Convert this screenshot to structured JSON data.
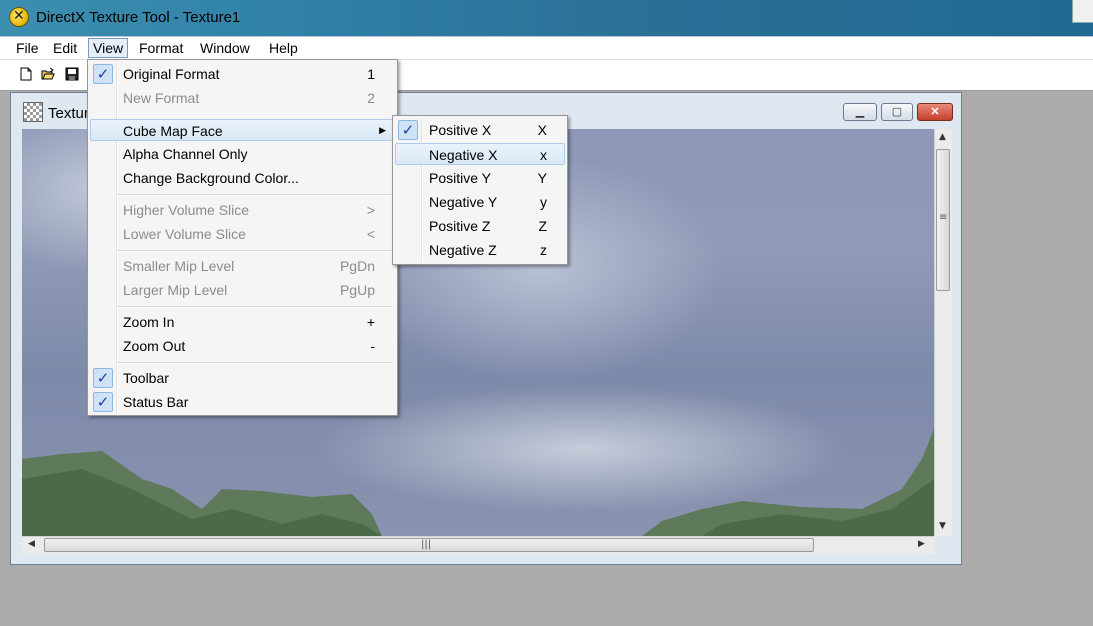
{
  "app": {
    "title": "DirectX Texture Tool - Texture1"
  },
  "menubar": {
    "items": [
      "File",
      "Edit",
      "View",
      "Format",
      "Window",
      "Help"
    ],
    "active": "View"
  },
  "toolbar": {
    "buttons": [
      "new-file-icon",
      "open-folder-icon",
      "save-icon"
    ]
  },
  "document": {
    "title": "Textur"
  },
  "view_menu": {
    "items": [
      {
        "label": "Original Format",
        "shortcut": "1",
        "checked": true,
        "enabled": true
      },
      {
        "label": "New Format",
        "shortcut": "2",
        "checked": false,
        "enabled": false
      },
      {
        "label": "Cube Map Face",
        "shortcut": "",
        "checked": false,
        "enabled": true,
        "submenu": true,
        "highlighted": true
      },
      {
        "label": "Alpha Channel Only",
        "shortcut": "",
        "checked": false,
        "enabled": true
      },
      {
        "label": "Change Background Color...",
        "shortcut": "",
        "checked": false,
        "enabled": true
      },
      {
        "label": "Higher Volume Slice",
        "shortcut": ">",
        "checked": false,
        "enabled": false
      },
      {
        "label": "Lower Volume Slice",
        "shortcut": "<",
        "checked": false,
        "enabled": false
      },
      {
        "label": "Smaller Mip Level",
        "shortcut": "PgDn",
        "checked": false,
        "enabled": false
      },
      {
        "label": "Larger Mip Level",
        "shortcut": "PgUp",
        "checked": false,
        "enabled": false
      },
      {
        "label": "Zoom In",
        "shortcut": "+",
        "checked": false,
        "enabled": true
      },
      {
        "label": "Zoom Out",
        "shortcut": "-",
        "checked": false,
        "enabled": true
      },
      {
        "label": "Toolbar",
        "shortcut": "",
        "checked": true,
        "enabled": true
      },
      {
        "label": "Status Bar",
        "shortcut": "",
        "checked": true,
        "enabled": true
      }
    ]
  },
  "cube_submenu": {
    "items": [
      {
        "label": "Positive X",
        "shortcut": "X",
        "checked": true
      },
      {
        "label": "Negative X",
        "shortcut": "x",
        "checked": false,
        "highlighted": true
      },
      {
        "label": "Positive Y",
        "shortcut": "Y",
        "checked": false
      },
      {
        "label": "Negative Y",
        "shortcut": "y",
        "checked": false
      },
      {
        "label": "Positive Z",
        "shortcut": "Z",
        "checked": false
      },
      {
        "label": "Negative Z",
        "shortcut": "z",
        "checked": false
      }
    ]
  },
  "glyphs": {
    "check": "✓",
    "submenu_arrow": "▶",
    "grip": "≡",
    "hgrip": "|||"
  },
  "colors": {
    "titlebar": "#2f7fa6",
    "highlight": "#d9e8f7",
    "check_box": "#cfe3f8",
    "close_button": "#c5412c"
  }
}
